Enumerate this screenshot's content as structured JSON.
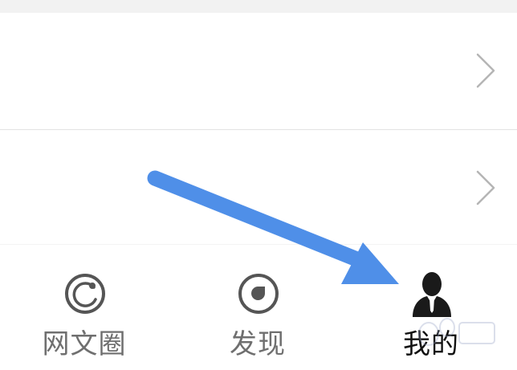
{
  "tabbar": {
    "tabs": [
      {
        "label": "网文圈",
        "icon": "circle-refresh-icon",
        "active": false
      },
      {
        "label": "发现",
        "icon": "discover-drop-icon",
        "active": false
      },
      {
        "label": "我的",
        "icon": "user-silhouette-icon",
        "active": true
      }
    ]
  },
  "colors": {
    "arrow": "#4f8fe8",
    "icon": "#555555",
    "label": "#6f6f6f",
    "label_active": "#111111",
    "divider": "#e3e3e3"
  }
}
